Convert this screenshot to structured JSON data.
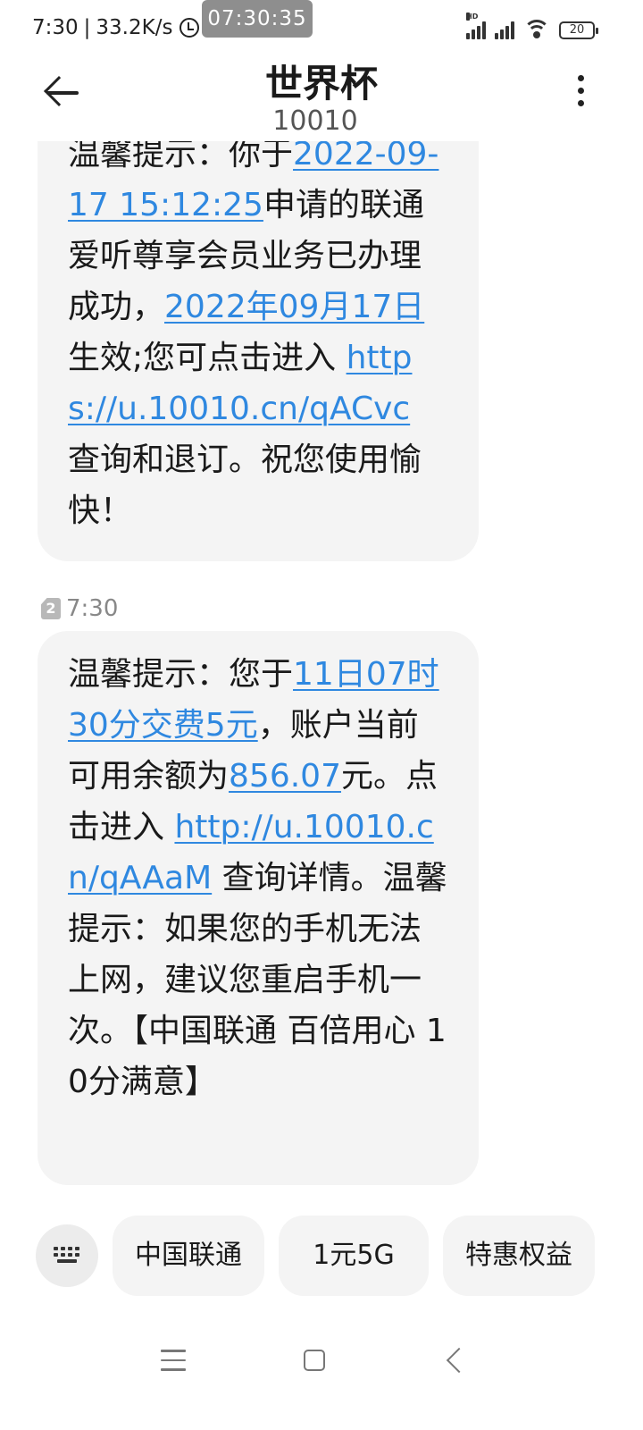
{
  "status_bar": {
    "time": "7:30",
    "speed": "33.2K/s",
    "clock_overlay": "07:30:35",
    "network_type": "HD",
    "battery": "20"
  },
  "header": {
    "title": "世界杯",
    "subtitle": "10010"
  },
  "messages": [
    {
      "parts": [
        {
          "text": "温馨提示：你于",
          "link": false
        },
        {
          "text": "2022-09-17 15:12:25",
          "link": true
        },
        {
          "text": "申请的联通爱听尊享会员业务已办理成功，",
          "link": false
        },
        {
          "text": "2022年09月17日",
          "link": true
        },
        {
          "text": "生效;您可点击进入 ",
          "link": false
        },
        {
          "text": "https://u.10010.cn/qACvc",
          "link": true
        },
        {
          "text": " 查询和退订。祝您使用愉快！",
          "link": false
        }
      ]
    },
    {
      "sim": "2",
      "time": "7:30",
      "parts": [
        {
          "text": "温馨提示：您于",
          "link": false
        },
        {
          "text": "11日07时30分交费5元",
          "link": true
        },
        {
          "text": "，账户当前可用余额为",
          "link": false
        },
        {
          "text": "856.07",
          "link": true
        },
        {
          "text": "元。点击进入 ",
          "link": false
        },
        {
          "text": "http://u.10010.cn/qAAaM",
          "link": true
        },
        {
          "text": " 查询详情。温馨提示：如果您的手机无法上网，建议您重启手机一次。【中国联通 百倍用心 10分满意】",
          "link": false
        }
      ]
    }
  ],
  "quick_replies": {
    "keyboard_icon": "keyboard-icon",
    "chips": [
      "中国联通",
      "1元5G",
      "特惠权益"
    ]
  },
  "nav_bar": {
    "icons": [
      "menu-icon",
      "home-icon",
      "back-icon"
    ]
  }
}
